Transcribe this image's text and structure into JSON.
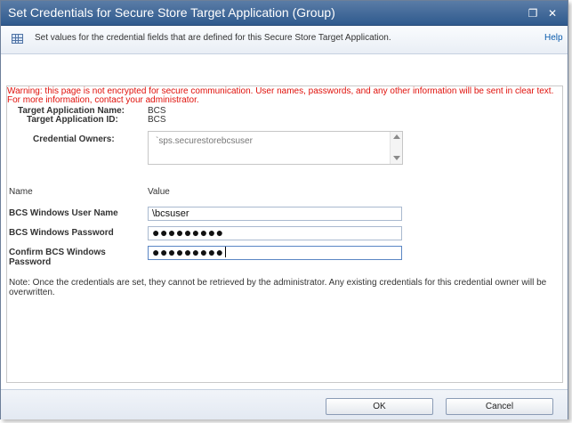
{
  "dialog": {
    "title": "Set Credentials for Secure Store Target Application (Group)",
    "info_text": "Set values for the credential fields that are defined for this Secure Store Target Application.",
    "help_label": "Help"
  },
  "warning": "Warning: this page is not encrypted for secure communication. User names, passwords, and any other information will be sent in clear text. For more information, contact your administrator.",
  "target_app": {
    "name_label": "Target Application Name:",
    "name_value": "BCS",
    "id_label": "Target Application ID:",
    "id_value": "BCS"
  },
  "owners": {
    "label": "Credential Owners:",
    "value": "`sps.securestorebcsuser"
  },
  "fields_header": {
    "name": "Name",
    "value": "Value"
  },
  "fields": {
    "user_name_label": "BCS Windows User Name",
    "user_name_value": "\\bcsuser",
    "password_label": "BCS Windows Password",
    "password_value": "●●●●●●●●●",
    "confirm_label_line1": "Confirm BCS Windows",
    "confirm_label_line2": "Password",
    "confirm_value": "●●●●●●●●●"
  },
  "note": "Note: Once the credentials are set, they cannot be retrieved by the administrator. Any existing credentials for this credential owner will be overwritten.",
  "buttons": {
    "ok": "OK",
    "cancel": "Cancel"
  },
  "icons": {
    "title_bar_1": "restore-icon",
    "title_bar_2": "close-icon",
    "info": "table-icon"
  }
}
